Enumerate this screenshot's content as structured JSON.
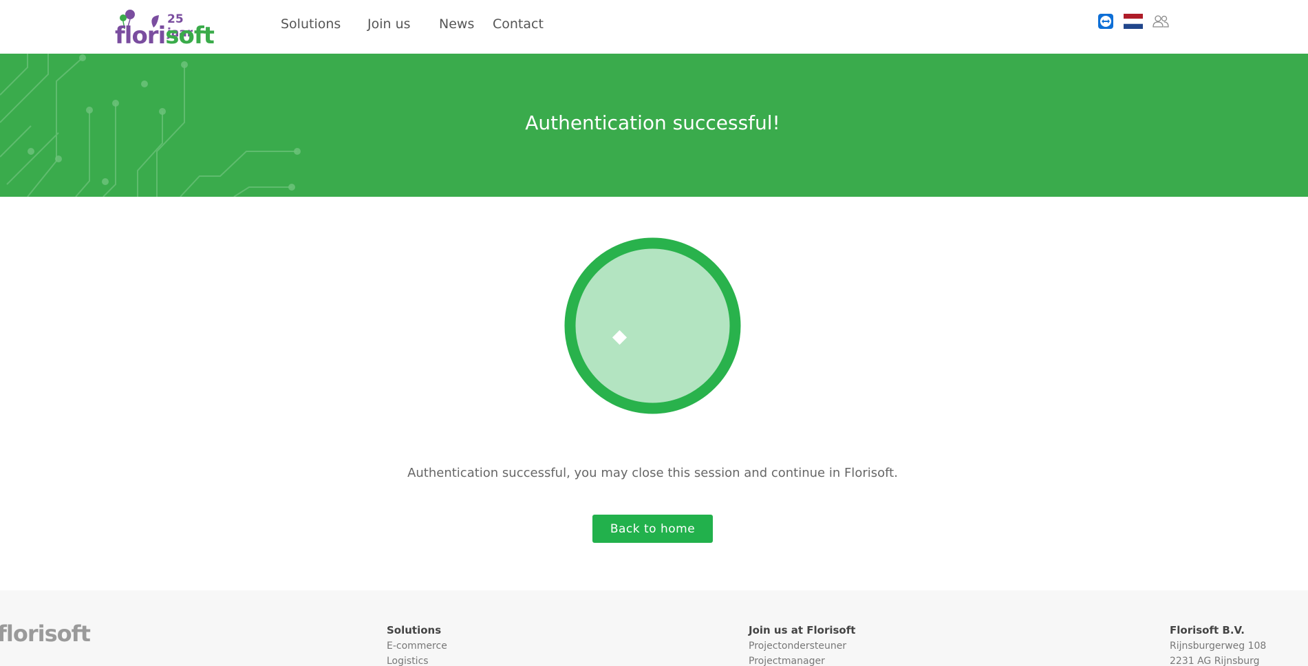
{
  "header": {
    "logo": {
      "brand_part1": "flori",
      "brand_part2": "soft",
      "anniversary": "25 jaar"
    },
    "nav": [
      {
        "label": "Solutions"
      },
      {
        "label": "Join us"
      },
      {
        "label": "News"
      },
      {
        "label": "Contact"
      }
    ],
    "icons": [
      "teamviewer-icon",
      "dutch-flag-icon",
      "users-icon"
    ]
  },
  "banner": {
    "title": "Authentication successful!"
  },
  "main": {
    "message": "Authentication successful, you may close this session and continue in Florisoft.",
    "button_label": "Back to home"
  },
  "footer": {
    "logo": "florisoft",
    "solutions": {
      "heading": "Solutions",
      "items": [
        "E-commerce",
        "Logistics"
      ]
    },
    "join": {
      "heading": "Join us at Florisoft",
      "items": [
        "Projectondersteuner",
        "Projectmanager"
      ]
    },
    "company": {
      "heading": "Florisoft B.V.",
      "items": [
        "Rijnsburgerweg 108",
        "2231 AG Rijnsburg"
      ]
    }
  },
  "colors": {
    "brand_green": "#3aab4c",
    "button_green": "#22b14c",
    "brand_purple": "#7a4d9f",
    "circle_ring": "#29b24c",
    "circle_fill": "#b3e4c1"
  }
}
